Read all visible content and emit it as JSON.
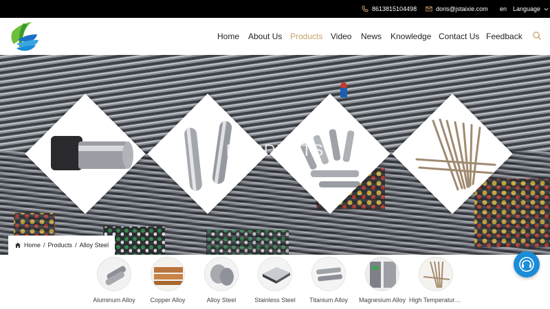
{
  "topbar": {
    "phone": "8613815104498",
    "email": "doris@jstaixie.com",
    "lang_code": "en",
    "lang_label": "Language"
  },
  "nav": [
    {
      "label": "Home",
      "active": false
    },
    {
      "label": "About Us",
      "active": false
    },
    {
      "label": "Products",
      "active": true
    },
    {
      "label": "Video",
      "active": false
    },
    {
      "label": "News",
      "active": false
    },
    {
      "label": "Knowledge",
      "active": false
    },
    {
      "label": "Contact Us",
      "active": false
    },
    {
      "label": "Feedback",
      "active": false
    }
  ],
  "hero": {
    "title": "PRODUCTS"
  },
  "breadcrumb": {
    "home": "Home",
    "sep1": "/",
    "products": "Products",
    "sep2": "/",
    "current": "Alloy Steel"
  },
  "categories": [
    {
      "label": "Aluminum Alloy"
    },
    {
      "label": "Copper Alloy"
    },
    {
      "label": "Alloy Steel"
    },
    {
      "label": "Stainless Steel"
    },
    {
      "label": "Titanium Alloy"
    },
    {
      "label": "Magnesium Alloy"
    },
    {
      "label": "High Temperature Alloy"
    }
  ],
  "colors": {
    "accent": "#c8a06a",
    "topbar_bg": "#000000",
    "chat_bg": "#1a8cd8"
  },
  "icons": {
    "phone": "phone-icon",
    "email": "mail-icon",
    "language": "chevron-down-icon",
    "search": "search-icon",
    "home": "home-icon",
    "chat": "headset-icon"
  }
}
